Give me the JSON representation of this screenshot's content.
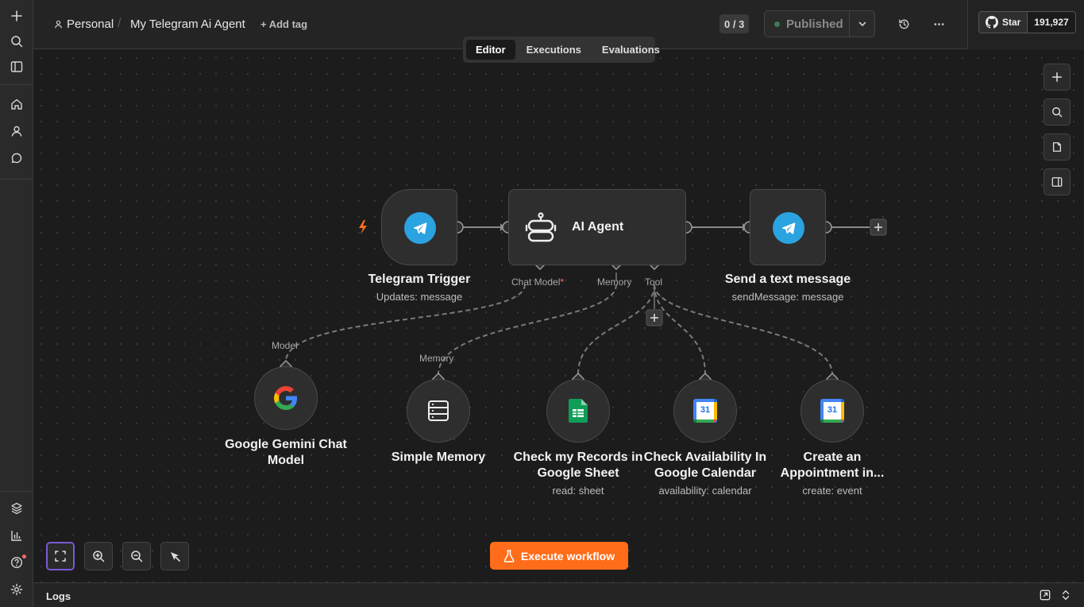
{
  "header": {
    "project": "Personal",
    "workflow_name": "My Telegram Ai Agent",
    "add_tag": "+ Add tag",
    "counter": "0 / 3",
    "publish_label": "Published",
    "github": {
      "star_label": "Star",
      "count": "191,927"
    }
  },
  "tabs": [
    {
      "label": "Editor",
      "active": true
    },
    {
      "label": "Executions",
      "active": false
    },
    {
      "label": "Evaluations",
      "active": false
    }
  ],
  "nodes": {
    "telegram_trigger": {
      "title": "Telegram Trigger",
      "subtitle": "Updates: message"
    },
    "ai_agent": {
      "title": "AI Agent"
    },
    "send_message": {
      "title": "Send a text message",
      "subtitle": "sendMessage: message"
    },
    "gemini": {
      "title": "Google Gemini Chat Model"
    },
    "memory": {
      "title": "Simple Memory"
    },
    "sheet": {
      "title": "Check my Records in Google Sheet",
      "subtitle": "read: sheet"
    },
    "availability": {
      "title": "Check Availability In Google Calendar",
      "subtitle": "availability: calendar"
    },
    "appointment": {
      "title": "Create an Appointment in...",
      "subtitle": "create: event"
    }
  },
  "ports": {
    "chat_model": "Chat Model",
    "required_mark": "*",
    "memory": "Memory",
    "tool": "Tool",
    "model_in": "Model",
    "memory_in": "Memory"
  },
  "calendar_day": "31",
  "execute_label": "Execute workflow",
  "logs_label": "Logs",
  "colors": {
    "accent": "#ff6d1a",
    "telegram": "#2aa3e0",
    "published_dot": "#3b7b55",
    "sheets_green": "#0f9d58"
  }
}
